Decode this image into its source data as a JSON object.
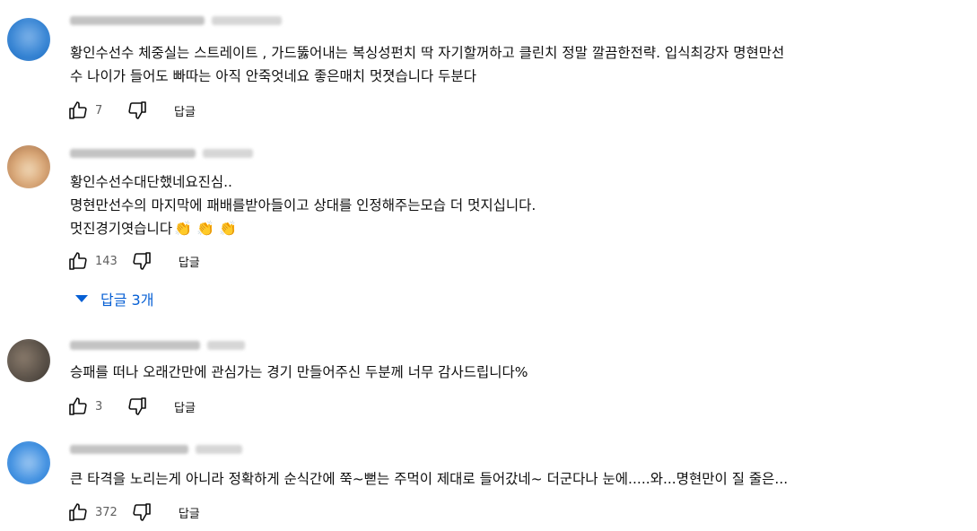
{
  "comments": [
    {
      "avatar_color": "#2f7fd1",
      "text": "황인수선수 체중실는 스트레이트 , 가드뚫어내는 복싱성펀치 딱 자기할꺼하고 클린치 정말 깔끔한전략. 입식최강자 명현만선\n수 나이가 들어도 빠따는 아직 안죽엇네요 좋은매치 멋졋습니다 두분다",
      "likes": "7",
      "reply_label": "답글"
    },
    {
      "avatar_color": "#c48a5a",
      "text": "황인수선수대단했네요진심..\n명현만선수의 마지막에 패배를받아들이고 상대를 인정해주는모습 더 멋지십니다.\n멋진경기엿습니다",
      "emoji": "👏 👏 👏",
      "likes": "143",
      "reply_label": "답글",
      "replies_toggle": "답글 3개"
    },
    {
      "avatar_color": "#5a5148",
      "text": "승패를 떠나 오래간만에 관심가는 경기 만들어주신 두분께 너무 감사드립니다%",
      "likes": "3",
      "reply_label": "답글"
    },
    {
      "avatar_color": "#3b8de0",
      "text": "큰 타격을 노리는게 아니라 정확하게 순식간에 쭉~뻗는 주먹이 제대로 들어갔네~ 더군다나 눈에.....와...명현만이 질 줄은...",
      "likes": "372",
      "reply_label": "답글"
    }
  ],
  "icons": {
    "like": "thumbs-up-icon",
    "dislike": "thumbs-down-icon",
    "expand": "triangle-down-icon"
  },
  "colors": {
    "link_blue": "#065fd4",
    "meta_gray": "#606060"
  }
}
